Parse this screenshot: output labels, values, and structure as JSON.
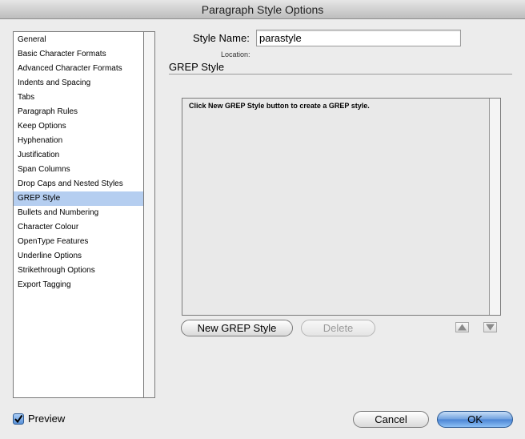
{
  "window": {
    "title": "Paragraph Style Options"
  },
  "sidebar": {
    "items": [
      {
        "label": "General",
        "selected": false
      },
      {
        "label": "Basic Character Formats",
        "selected": false
      },
      {
        "label": "Advanced Character Formats",
        "selected": false
      },
      {
        "label": "Indents and Spacing",
        "selected": false
      },
      {
        "label": "Tabs",
        "selected": false
      },
      {
        "label": "Paragraph Rules",
        "selected": false
      },
      {
        "label": "Keep Options",
        "selected": false
      },
      {
        "label": "Hyphenation",
        "selected": false
      },
      {
        "label": "Justification",
        "selected": false
      },
      {
        "label": "Span Columns",
        "selected": false
      },
      {
        "label": "Drop Caps and Nested Styles",
        "selected": false
      },
      {
        "label": "GREP Style",
        "selected": true
      },
      {
        "label": "Bullets and Numbering",
        "selected": false
      },
      {
        "label": "Character Colour",
        "selected": false
      },
      {
        "label": "OpenType Features",
        "selected": false
      },
      {
        "label": "Underline Options",
        "selected": false
      },
      {
        "label": "Strikethrough Options",
        "selected": false
      },
      {
        "label": "Export Tagging",
        "selected": false
      }
    ],
    "selected_color": "#b5cef0"
  },
  "style_name": {
    "label": "Style Name:",
    "value": "parastyle"
  },
  "location": {
    "label": "Location:"
  },
  "section": {
    "title": "GREP Style"
  },
  "grep_list": {
    "message": "Click New GREP Style button to create a GREP style."
  },
  "buttons": {
    "new_grep_style": "New GREP Style",
    "delete": "Delete",
    "move_up_icon": "triangle-up-icon",
    "move_down_icon": "triangle-down-icon",
    "cancel": "Cancel",
    "ok": "OK"
  },
  "preview": {
    "label": "Preview",
    "checked": true
  },
  "colors": {
    "accent": "#4a84d4",
    "background": "#ececec"
  }
}
